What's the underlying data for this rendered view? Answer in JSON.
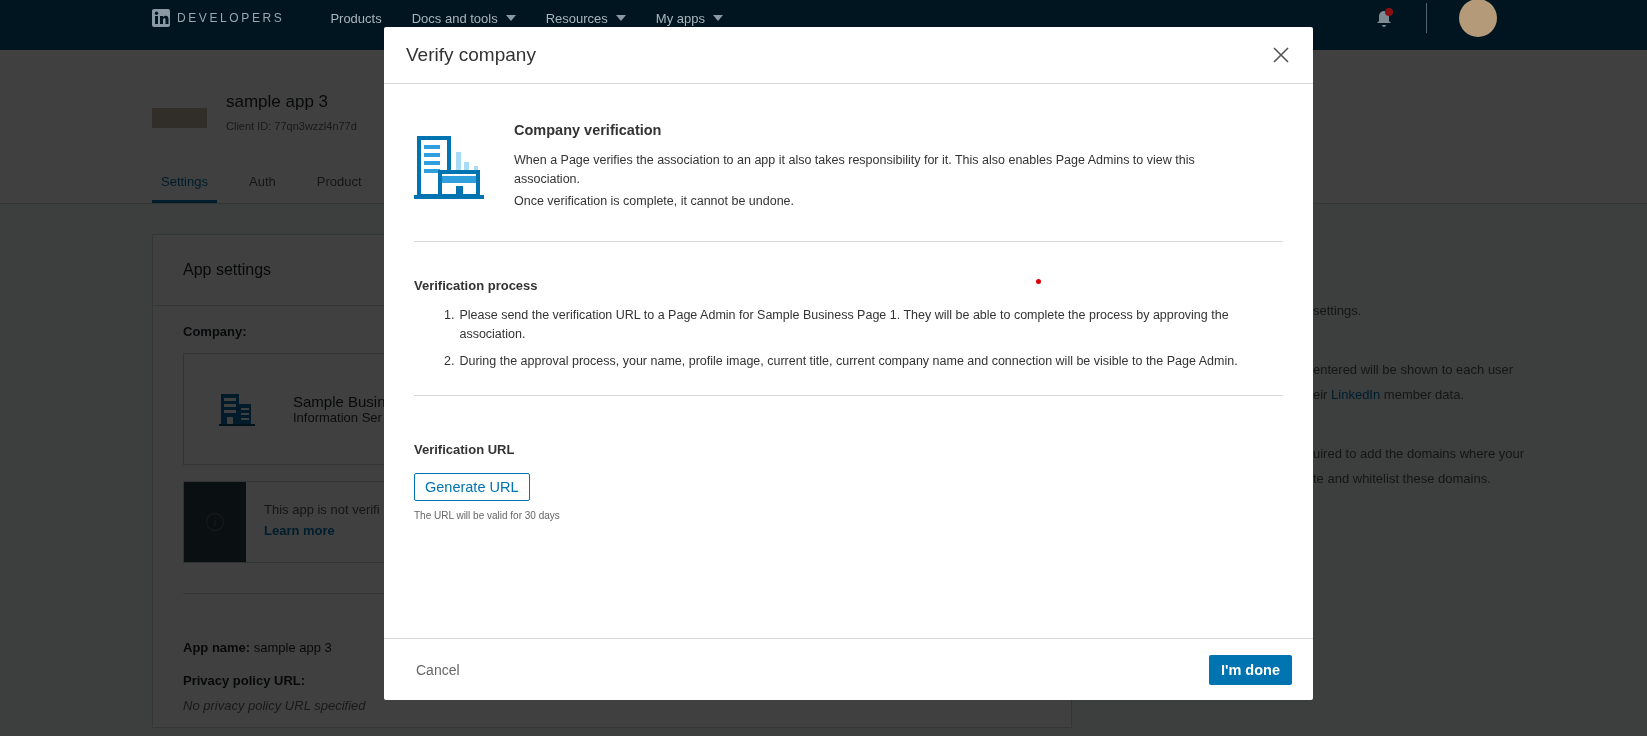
{
  "nav": {
    "brand": "DEVELOPERS",
    "items": [
      {
        "label": "Products",
        "dropdown": false
      },
      {
        "label": "Docs and tools",
        "dropdown": true
      },
      {
        "label": "Resources",
        "dropdown": true
      },
      {
        "label": "My apps",
        "dropdown": true
      }
    ]
  },
  "app": {
    "name": "sample app 3",
    "client_id": "Client ID: 77qn3wzzl4n77d"
  },
  "tabs": [
    {
      "label": "Settings",
      "selected": true
    },
    {
      "label": "Auth",
      "selected": false
    },
    {
      "label": "Product",
      "selected": false
    }
  ],
  "settings_card": {
    "title": "App settings",
    "company_label": "Company:",
    "company": {
      "name": "Sample Busin",
      "industry": "Information Ser"
    },
    "alert": {
      "text": "This app is not verifi",
      "link": "Learn more"
    },
    "fields": [
      {
        "kind": "value",
        "text": "**App name:** sample app 3"
      },
      {
        "kind": "heading",
        "text": "Privacy policy URL:"
      },
      {
        "kind": "empty",
        "text": "No privacy policy URL specified"
      }
    ]
  },
  "side_panel": {
    "paragraphs": [
      [
        {
          "text": "settings."
        }
      ],
      [
        {
          "text": "entered will be shown to each user"
        },
        {
          "text": "eir ",
          "link": "LinkedIn",
          "after": " member data."
        }
      ],
      [
        {
          "text": "uired to add the domains where your"
        },
        {
          "text": "te and whitelist these domains."
        }
      ]
    ]
  },
  "modal": {
    "title": "Verify company",
    "intro": {
      "title": "Company verification",
      "paragraphs": [
        "When a Page verifies the association to an app it also takes responsibility for it. This also enables Page Admins to view this association.",
        "Once verification is complete, it cannot be undone."
      ]
    },
    "process": {
      "title": "Verification process",
      "steps": [
        {
          "number": "1.",
          "text": "Please send the verification URL to a Page Admin for Sample Business Page 1. They will be able to complete the process by approving the association."
        },
        {
          "number": "2.",
          "text": "During the approval process, your name, profile image, current title, current company name and connection will be visible to the Page Admin."
        }
      ]
    },
    "url": {
      "title": "Verification URL",
      "button": "Generate URL",
      "note": "The URL will be valid for 30 days"
    },
    "cancel": "Cancel",
    "done": "I'm done"
  }
}
